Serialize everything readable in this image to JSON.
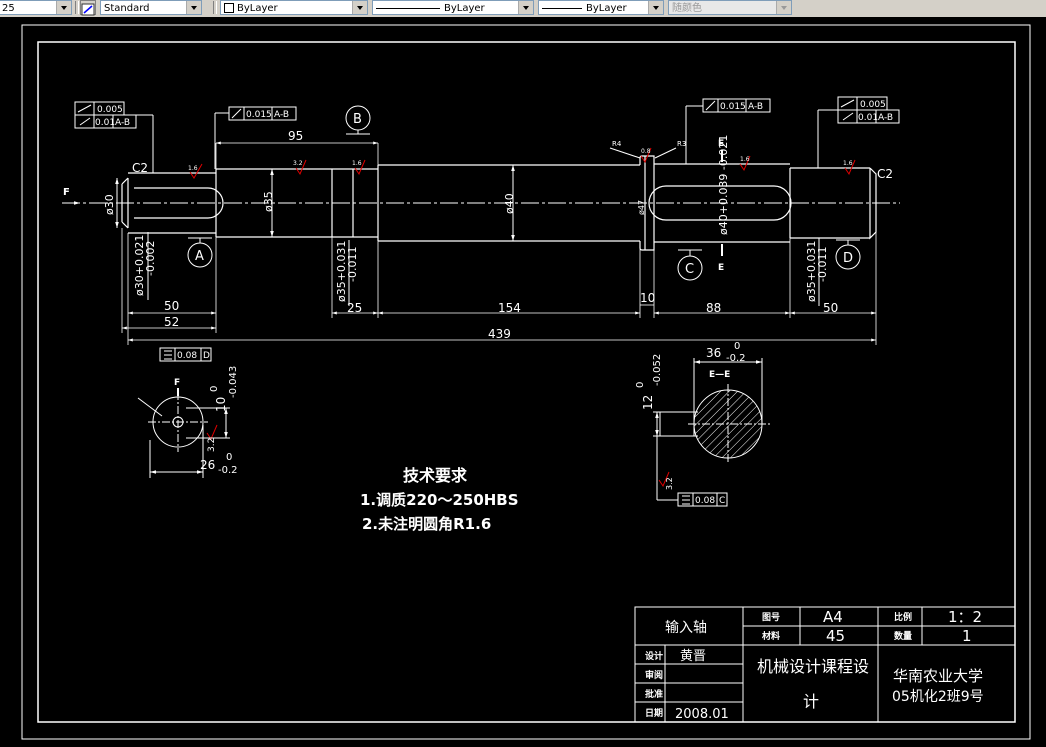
{
  "toolbar": {
    "scale_value": "25",
    "text_style": "Standard",
    "layer": "ByLayer",
    "linetype": "ByLayer",
    "lineweight": "ByLayer",
    "plot_style": "随颜色"
  },
  "drawing": {
    "title_block": {
      "part_name": "输入轴",
      "drawing_no_label": "图号",
      "drawing_no": "A4",
      "material_label": "材料",
      "material": "45",
      "scale_label": "比例",
      "scale": "1：2",
      "quantity_label": "数量",
      "quantity": "1",
      "designer_label": "设计",
      "designer": "黄晋",
      "reviewer_label": "审阅",
      "approver_label": "批准",
      "date_label": "日期",
      "date": "2008.01",
      "course_line1": "机械设计课程设",
      "course_line2": "计",
      "school": "华南农业大学",
      "class": "05机化2班9号"
    },
    "notes": {
      "title": "技术要求",
      "item1": "1.调质220～250HBS",
      "item2": "2.未注明圆角R1.6"
    },
    "dimensions": {
      "d95": "95",
      "d50a": "50",
      "d52": "52",
      "d25": "25",
      "d154": "154",
      "d10": "10",
      "d88": "88",
      "d50b": "50",
      "d439": "439",
      "phi30": "ø30",
      "phi35": "ø35",
      "phi40": "ø40",
      "phi47": "ø47",
      "phi40tol": "ø40+0.039 -0.021",
      "tol_a1": "ø30+0.021",
      "tol_a2": "-0.002",
      "tol_b1": "ø35+0.031",
      "tol_b2": "-0.011",
      "tol_d1": "ø35+0.031",
      "tol_d2": "-0.011",
      "c2_left": "C2",
      "c2_right": "C2",
      "r4": "R4",
      "r3": "R3",
      "rough_16": "1.6",
      "rough_32": "3.2",
      "rough_08": "0.8"
    },
    "tolerances": {
      "left_runout": "0.005",
      "left_runout_ab": "0.01",
      "left_ref": "A-B",
      "mid_runout": "0.015",
      "mid_ref": "A-B",
      "right_mid_runout": "0.015",
      "right_mid_ref": "A-B",
      "right_runout": "0.005",
      "right_runout_ab": "0.01",
      "right_ref": "A-B",
      "sym_left": "0.08",
      "sym_left_ref": "D",
      "sym_right": "0.08",
      "sym_right_ref": "C"
    },
    "datums": {
      "a": "A",
      "b": "B",
      "c": "C",
      "d": "D"
    },
    "section_marks": {
      "e_top": "E",
      "e_bottom": "E",
      "section_title": "E—E",
      "f_arrow": "F",
      "f_view": "F"
    },
    "sections": {
      "left_10": "10",
      "left_10_tol": "0",
      "left_10_tol2": "-0.043",
      "left_26": "26",
      "left_26_tol": "0",
      "left_26_tol2": "-0.2",
      "right_36": "36",
      "right_36_tol": "0",
      "right_36_tol2": "-0.2",
      "right_12": "12",
      "right_12_tol": "0",
      "right_12_tol2": "-0.052"
    }
  }
}
